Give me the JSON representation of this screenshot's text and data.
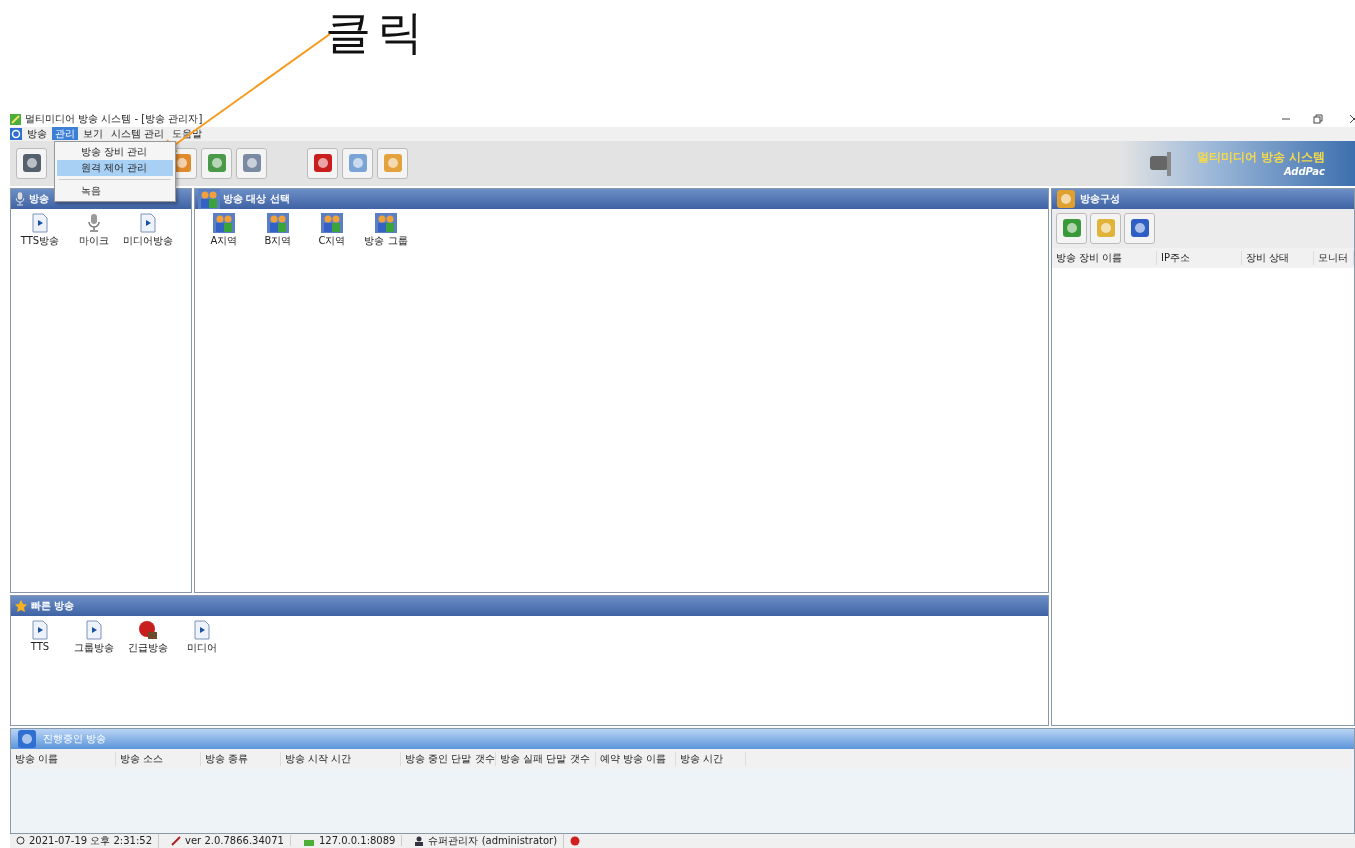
{
  "annotation": {
    "text": "클릭"
  },
  "window": {
    "title": "멀티미디어 방송 시스템 - [방송 관리자]"
  },
  "menu": [
    {
      "label": "방송",
      "selected": false
    },
    {
      "label": "관리",
      "selected": true
    },
    {
      "label": "보기",
      "selected": false
    },
    {
      "label": "시스템 관리",
      "selected": false
    },
    {
      "label": "도움말",
      "selected": false
    }
  ],
  "dropdown": [
    {
      "label": "방송 장비 관리",
      "selected": false,
      "kind": "item"
    },
    {
      "label": "원격 제어 관리",
      "selected": true,
      "kind": "item"
    },
    {
      "kind": "separator"
    },
    {
      "label": "녹음",
      "selected": false,
      "kind": "item"
    }
  ],
  "logo": {
    "title": "멀티미디어 방송 시스템",
    "brand": "AddPac"
  },
  "source_panel": {
    "title": "방송",
    "items": [
      {
        "label": "TTS방송",
        "kind": "file"
      },
      {
        "label": "마이크",
        "kind": "mic"
      },
      {
        "label": "미디어방송",
        "kind": "file"
      }
    ]
  },
  "target_panel": {
    "title": "방송 대상 선택",
    "items": [
      {
        "label": "A지역"
      },
      {
        "label": "B지역"
      },
      {
        "label": "C지역"
      },
      {
        "label": "방송 그룹"
      }
    ]
  },
  "config_panel": {
    "title": "방송구성",
    "columns": [
      "방송 장비 이름",
      "IP주소",
      "장비 상태",
      "모니터"
    ]
  },
  "quick_panel": {
    "title": "빠른 방송",
    "items": [
      {
        "label": "TTS",
        "kind": "file"
      },
      {
        "label": "그룹방송",
        "kind": "file"
      },
      {
        "label": "긴급방송",
        "kind": "alert"
      },
      {
        "label": "미디어",
        "kind": "file"
      }
    ]
  },
  "active_panel": {
    "title": "진행중인 방송",
    "columns": [
      "방송 이름",
      "방송 소스",
      "방송 종류",
      "방송 시작 시간",
      "방송 중인 단말 갯수",
      "방송 실패 단말 갯수",
      "예약 방송 이름",
      "방송 시간"
    ]
  },
  "status_bar": {
    "time": "2021-07-19 오후 2:31:52",
    "version": "ver 2.0.7866.34071",
    "address": "127.0.0.1:8089",
    "user": "슈퍼관리자 (administrator)"
  }
}
